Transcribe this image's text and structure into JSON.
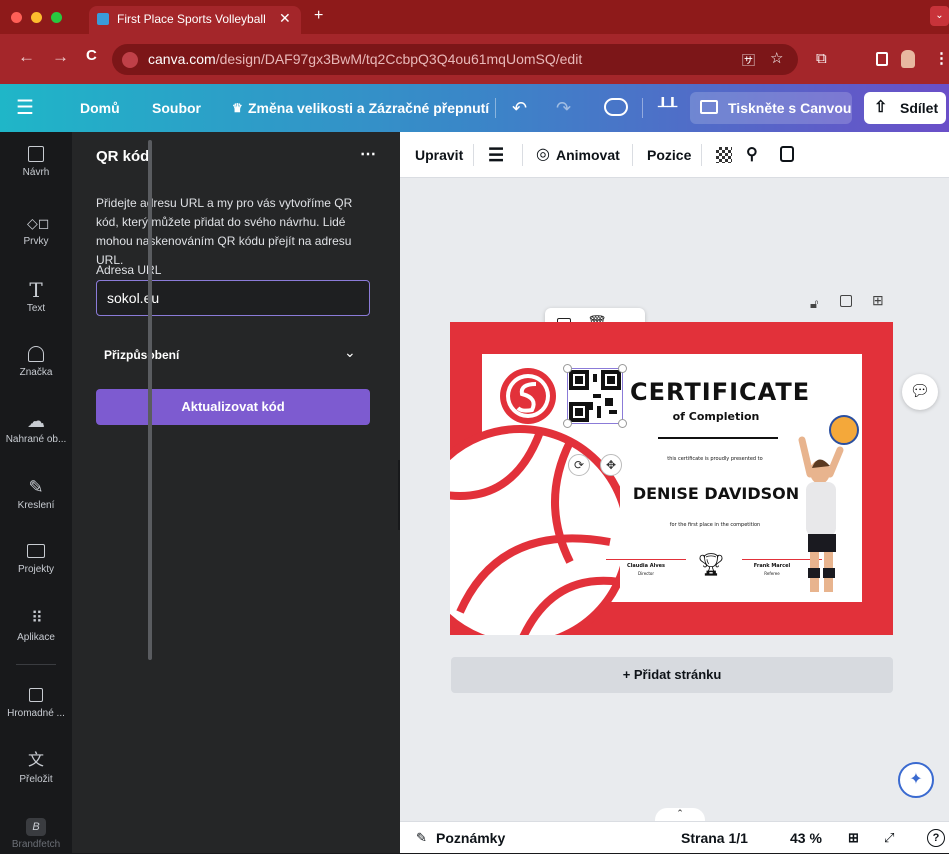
{
  "browser": {
    "tab_title": "First Place Sports Volleyball C",
    "url_host": "canva.com",
    "url_path": "/design/DAF97gx3BwM/tq2CcbpQ3Q4ou61mqUomSQ/edit"
  },
  "header": {
    "home": "Domů",
    "file": "Soubor",
    "resize": "Změna velikosti a Zázračné přepnutí",
    "print": "Tiskněte s Canvou",
    "share": "Sdílet"
  },
  "rail": [
    {
      "label": "Návrh",
      "icon": "layout-icon"
    },
    {
      "label": "Prvky",
      "icon": "shapes-icon"
    },
    {
      "label": "Text",
      "icon": "text-icon"
    },
    {
      "label": "Značka",
      "icon": "brand-icon"
    },
    {
      "label": "Nahrané ob...",
      "icon": "upload-icon"
    },
    {
      "label": "Kreslení",
      "icon": "draw-icon"
    },
    {
      "label": "Projekty",
      "icon": "folder-icon"
    },
    {
      "label": "Aplikace",
      "icon": "apps-icon"
    },
    {
      "label": "Hromadné ...",
      "icon": "bulk-create-icon"
    },
    {
      "label": "Přeložit",
      "icon": "translate-icon"
    },
    {
      "label": "Brandfetch",
      "icon": "brandfetch-icon"
    }
  ],
  "panel": {
    "title": "QR kód",
    "description": "Přidejte adresu URL a my pro vás vytvoříme QR kód, který můžete přidat do svého návrhu. Lidé mohou naskenováním QR kódu přejít na adresu URL.",
    "url_label": "Adresa URL",
    "url_value": "sokol.eu",
    "customize": "Přizpůsobení",
    "update_button": "Aktualizovat kód"
  },
  "toolbar": {
    "edit": "Upravit",
    "animate": "Animovat",
    "position": "Pozice"
  },
  "certificate": {
    "title": "CERTIFICATE",
    "subtitle": "of Completion",
    "presented": "this certificate is proudly presented to",
    "name": "DENISE DAVIDSON",
    "reason": "for the first place in the competition",
    "sig1_name": "Claudia Alves",
    "sig1_role": "Director",
    "sig2_name": "Frank Marcel",
    "sig2_role": "Referee"
  },
  "canvas": {
    "add_page": "+ Přidat stránku"
  },
  "bottom": {
    "notes": "Poznámky",
    "page": "Strana 1/1",
    "zoom": "43 %"
  },
  "colors": {
    "brand_purple": "#7d5bd0",
    "certificate_red": "#e2313a",
    "browser_red": "#a4262a"
  }
}
